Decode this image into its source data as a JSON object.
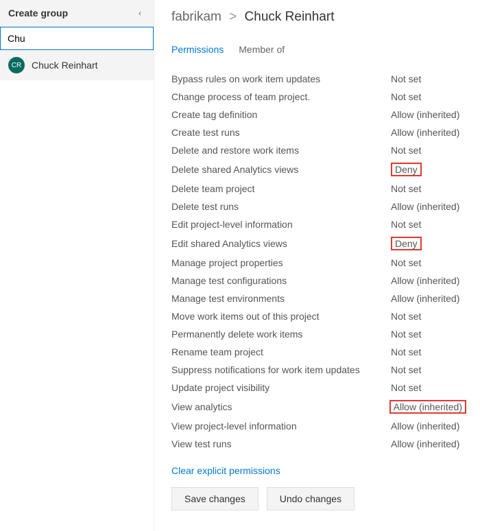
{
  "sidebar": {
    "create_group_label": "Create group",
    "search_value": "Chu",
    "user": {
      "initials": "CR",
      "name": "Chuck Reinhart"
    }
  },
  "breadcrumb": {
    "parent": "fabrikam",
    "separator": ">",
    "current": "Chuck Reinhart"
  },
  "tabs": {
    "permissions": "Permissions",
    "member_of": "Member of"
  },
  "permissions": [
    {
      "label": "Bypass rules on work item updates",
      "value": "Not set",
      "highlight": false
    },
    {
      "label": "Change process of team project.",
      "value": "Not set",
      "highlight": false
    },
    {
      "label": "Create tag definition",
      "value": "Allow (inherited)",
      "highlight": false
    },
    {
      "label": "Create test runs",
      "value": "Allow (inherited)",
      "highlight": false
    },
    {
      "label": "Delete and restore work items",
      "value": "Not set",
      "highlight": false
    },
    {
      "label": "Delete shared Analytics views",
      "value": "Deny",
      "highlight": true
    },
    {
      "label": "Delete team project",
      "value": "Not set",
      "highlight": false
    },
    {
      "label": "Delete test runs",
      "value": "Allow (inherited)",
      "highlight": false
    },
    {
      "label": "Edit project-level information",
      "value": "Not set",
      "highlight": false
    },
    {
      "label": "Edit shared Analytics views",
      "value": "Deny",
      "highlight": true
    },
    {
      "label": "Manage project properties",
      "value": "Not set",
      "highlight": false
    },
    {
      "label": "Manage test configurations",
      "value": "Allow (inherited)",
      "highlight": false
    },
    {
      "label": "Manage test environments",
      "value": "Allow (inherited)",
      "highlight": false
    },
    {
      "label": "Move work items out of this project",
      "value": "Not set",
      "highlight": false
    },
    {
      "label": "Permanently delete work items",
      "value": "Not set",
      "highlight": false
    },
    {
      "label": "Rename team project",
      "value": "Not set",
      "highlight": false
    },
    {
      "label": "Suppress notifications for work item updates",
      "value": "Not set",
      "highlight": false
    },
    {
      "label": "Update project visibility",
      "value": "Not set",
      "highlight": false
    },
    {
      "label": "View analytics",
      "value": "Allow (inherited)",
      "highlight": true
    },
    {
      "label": "View project-level information",
      "value": "Allow (inherited)",
      "highlight": false
    },
    {
      "label": "View test runs",
      "value": "Allow (inherited)",
      "highlight": false
    }
  ],
  "actions": {
    "clear_link": "Clear explicit permissions",
    "save": "Save changes",
    "undo": "Undo changes"
  }
}
